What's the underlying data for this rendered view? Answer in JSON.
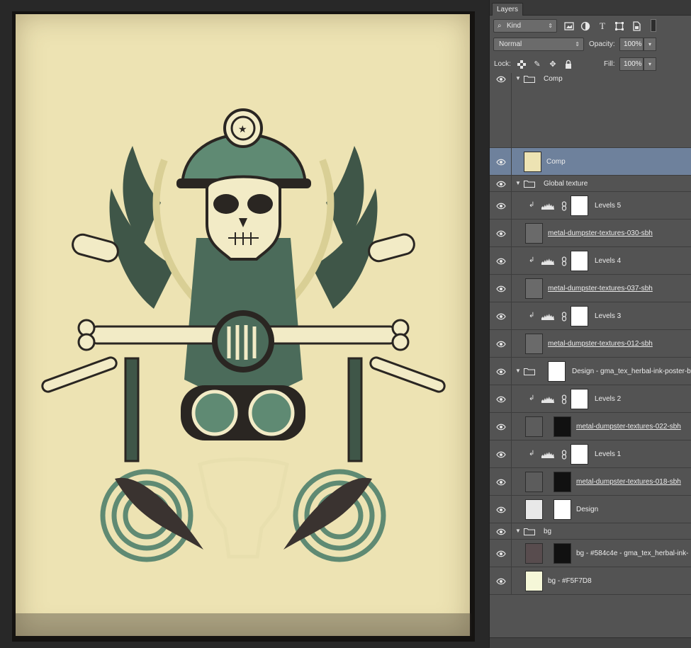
{
  "panel": {
    "tab_label": "Layers",
    "filter_kind": "Kind",
    "blend_mode": "Normal",
    "opacity_label": "Opacity:",
    "opacity_value": "100%",
    "lock_label": "Lock:",
    "fill_label": "Fill:",
    "fill_value": "100%"
  },
  "layers": [
    {
      "name": "Comp",
      "type": "group",
      "indent": 0
    },
    {
      "name": "Comp",
      "type": "smart",
      "indent": 1,
      "selected": true
    },
    {
      "name": "Global texture",
      "type": "group",
      "indent": 0
    },
    {
      "name": "Levels 5",
      "type": "adjustment",
      "indent": 1
    },
    {
      "name": "metal-dumpster-textures-030-sbh",
      "type": "texture",
      "indent": 1
    },
    {
      "name": "Levels 4",
      "type": "adjustment",
      "indent": 1
    },
    {
      "name": "metal-dumpster-textures-037-sbh",
      "type": "texture",
      "indent": 1
    },
    {
      "name": "Levels 3",
      "type": "adjustment",
      "indent": 1
    },
    {
      "name": "metal-dumpster-textures-012-sbh",
      "type": "texture",
      "indent": 1
    },
    {
      "name": "Design - gma_tex_herbal-ink-poster-b",
      "type": "group-masked",
      "indent": 0
    },
    {
      "name": "Levels 2",
      "type": "adjustment",
      "indent": 1
    },
    {
      "name": "metal-dumpster-textures-022-sbh",
      "type": "texture-masked",
      "indent": 1
    },
    {
      "name": "Levels 1",
      "type": "adjustment",
      "indent": 1
    },
    {
      "name": "metal-dumpster-textures-018-sbh",
      "type": "texture-masked",
      "indent": 1
    },
    {
      "name": "Design",
      "type": "design",
      "indent": 1
    },
    {
      "name": "bg",
      "type": "group",
      "indent": 0
    },
    {
      "name": "bg - #584c4e - gma_tex_herbal-ink-",
      "type": "color-masked",
      "indent": 1
    },
    {
      "name": "bg - #F5F7D8",
      "type": "color",
      "indent": 1
    }
  ],
  "colors": {
    "paper": "#ede3b3",
    "green": "#5f8a73",
    "dark": "#2a2622",
    "cream": "#f5efc8",
    "selection": "#6e819c",
    "bg_dark_swatch": "#584c4e",
    "bg_light_swatch": "#F5F7D8"
  },
  "icons": {
    "eye": "eye-icon",
    "folder": "folder-icon",
    "chain": "chain-link-icon",
    "levels": "levels-histogram-icon"
  }
}
